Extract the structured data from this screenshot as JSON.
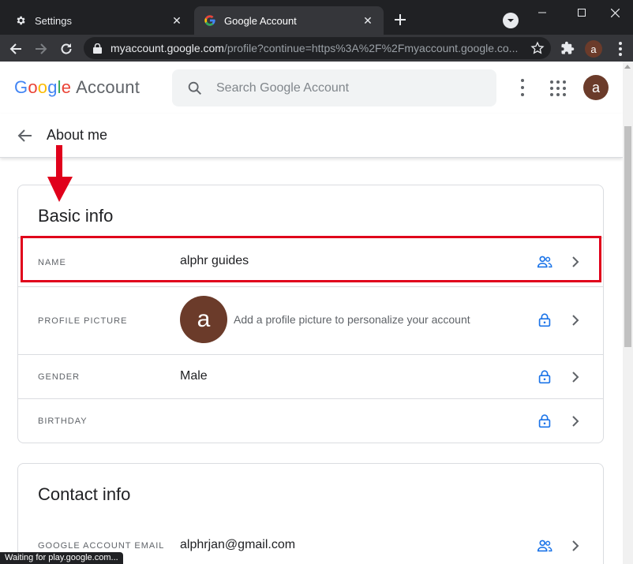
{
  "browser": {
    "tabs": [
      {
        "title": "Settings",
        "icon": "gear-icon",
        "active": false
      },
      {
        "title": "Google Account",
        "icon": "google-g-icon",
        "active": true
      }
    ],
    "url_domain": "myaccount.google.com",
    "url_path": "/profile?continue=https%3A%2F%2Fmyaccount.google.co...",
    "profile_initial": "a"
  },
  "header": {
    "logo": {
      "g1": "G",
      "g2": "o",
      "g3": "o",
      "g4": "g",
      "g5": "l",
      "g6": "e",
      "account": "Account"
    },
    "search_placeholder": "Search Google Account",
    "avatar_initial": "a"
  },
  "subheader": {
    "title": "About me"
  },
  "basic_info": {
    "title": "Basic info",
    "rows": [
      {
        "label": "NAME",
        "value": "alphr guides",
        "icon": "people-icon"
      },
      {
        "label": "PROFILE PICTURE",
        "value": "Add a profile picture to personalize your account",
        "avatar_initial": "a",
        "icon": "lock-icon"
      },
      {
        "label": "GENDER",
        "value": "Male",
        "icon": "lock-icon"
      },
      {
        "label": "BIRTHDAY",
        "value": "",
        "icon": "lock-icon"
      }
    ]
  },
  "contact_info": {
    "title": "Contact info",
    "rows": [
      {
        "label": "GOOGLE ACCOUNT EMAIL",
        "value": "alphrjan@gmail.com",
        "icon": "people-icon"
      }
    ]
  },
  "status_bar": "Waiting for play.google.com...",
  "colors": {
    "accent_blue": "#1a73e8",
    "annotation_red": "#e0001b",
    "avatar_brown": "#6b3b2a"
  }
}
